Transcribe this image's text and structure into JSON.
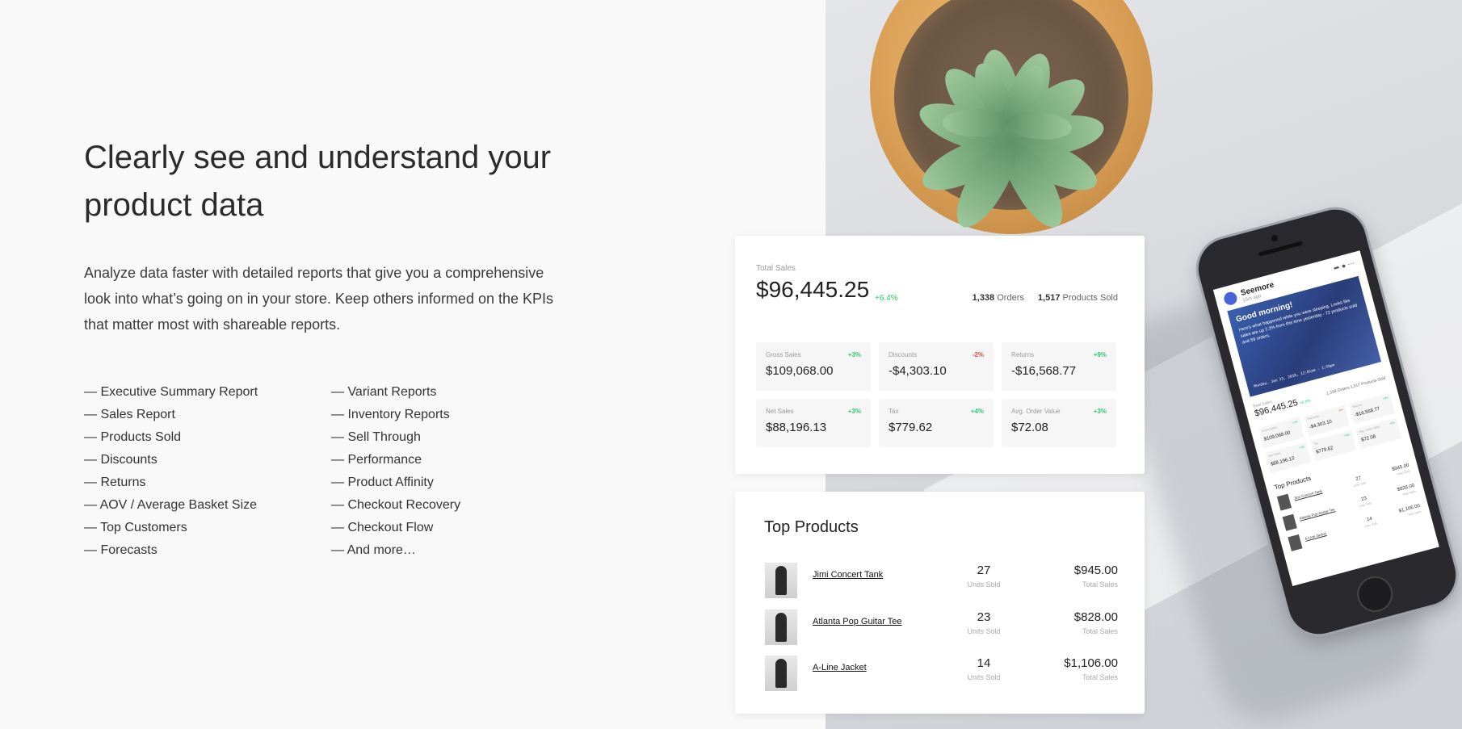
{
  "hero": {
    "title": "Clearly see and understand your product data",
    "description": "Analyze data faster with detailed reports that give you a comprehensive look into what’s going on in your store. Keep others informed on the KPIs that matter most with shareable reports."
  },
  "reports": {
    "column1": [
      "— Executive Summary Report",
      "— Sales Report",
      "— Products Sold",
      "— Discounts",
      "— Returns",
      "— AOV / Average Basket Size",
      "— Top Customers",
      "— Forecasts"
    ],
    "column2": [
      "— Variant Reports",
      "— Inventory Reports",
      "— Sell Through",
      "— Performance",
      "— Product Affinity",
      "— Checkout Recovery",
      "— Checkout Flow",
      "— And more…"
    ]
  },
  "sales_card": {
    "label": "Total Sales",
    "value": "$96,445.25",
    "change": "+6.4%",
    "orders_count": "1,338",
    "orders_label": "Orders",
    "products_count": "1,517",
    "products_label": "Products Sold",
    "metrics": [
      {
        "label": "Gross Sales",
        "change": "+3%",
        "value": "$109,068.00"
      },
      {
        "label": "Discounts",
        "change": "-2%",
        "value": "-$4,303.10"
      },
      {
        "label": "Returns",
        "change": "+9%",
        "value": "-$16,568.77"
      },
      {
        "label": "Net Sales",
        "change": "+3%",
        "value": "$88,196.13"
      },
      {
        "label": "Tax",
        "change": "+4%",
        "value": "$779.62"
      },
      {
        "label": "Avg. Order Value",
        "change": "+3%",
        "value": "$72.08"
      }
    ]
  },
  "top_products": {
    "title": "Top Products",
    "units_label": "Units Sold",
    "total_label": "Total Sales",
    "rows": [
      {
        "name": "Jimi Concert Tank",
        "units": "27",
        "total": "$945.00"
      },
      {
        "name": "Atlanta Pop Guitar Tee",
        "units": "23",
        "total": "$828.00"
      },
      {
        "name": "A-Line Jacket",
        "units": "14",
        "total": "$1,106.00"
      }
    ]
  },
  "phone": {
    "app_name": "Seemore",
    "time_ago": "15m ago",
    "greeting": "Good morning!",
    "message": "Here's what happened while you were sleeping. Looks like sales are up 2.3% from this time yesterday - 72 products sold and 59 orders.",
    "date": "Monday, Jan 23, 2018, 12:01am - 1:59pm",
    "sales_label": "Total Sales",
    "sales_value": "$96,445.25",
    "sales_change": "+6.4%",
    "stats": "1,338 Orders   1,517 Products Sold",
    "metrics": [
      {
        "label": "Gross Sales",
        "change": "+3%",
        "value": "$109,068.00"
      },
      {
        "label": "Discounts",
        "change": "-2%",
        "value": "-$4,303.10"
      },
      {
        "label": "Returns",
        "change": "+9%",
        "value": "-$16,568.77"
      },
      {
        "label": "Net Sales",
        "change": "+3%",
        "value": "$88,196.13"
      },
      {
        "label": "Tax",
        "change": "+4%",
        "value": "$779.62"
      },
      {
        "label": "Avg. Order Value",
        "change": "+3%",
        "value": "$72.08"
      }
    ],
    "top_title": "Top Products",
    "rows": [
      {
        "name": "Jimi Concert Tank",
        "units": "27",
        "total": "$945.00"
      },
      {
        "name": "Atlanta Pop Guitar Tee",
        "units": "23",
        "total": "$828.00"
      },
      {
        "name": "A-Line Jacket",
        "units": "14",
        "total": "$1,106.00"
      }
    ],
    "units_label": "Units Sold",
    "total_label": "Total Sales"
  },
  "colors": {
    "positive": "#2ecc71",
    "negative": "#e74c3c",
    "brand": "#4a63d8"
  }
}
